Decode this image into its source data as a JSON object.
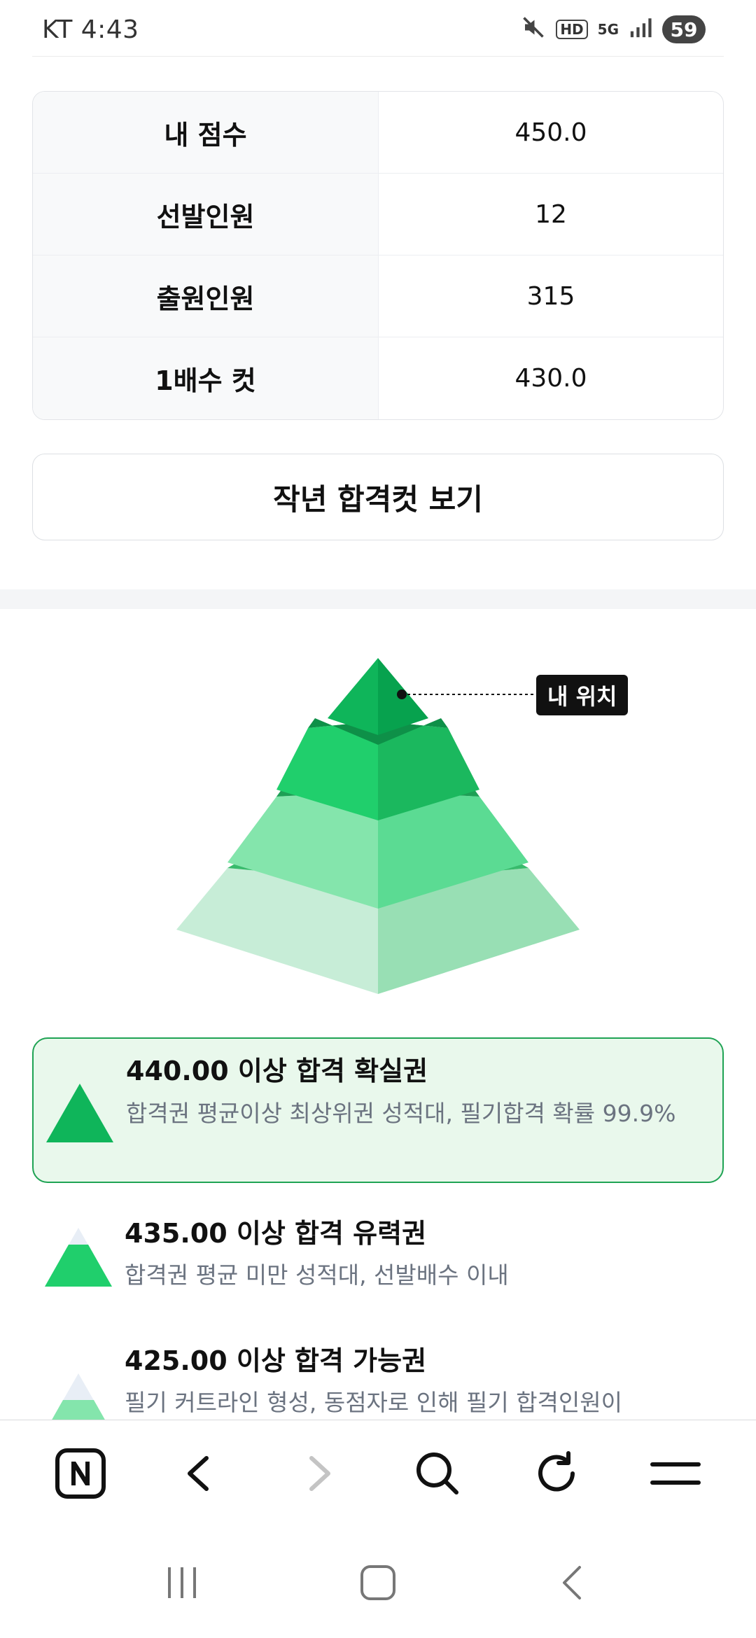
{
  "status": {
    "carrier_time": "KT 4:43",
    "hd": "HD",
    "network": "5G",
    "battery": "59"
  },
  "info_table": [
    {
      "label": "내 점수",
      "value": "450.0"
    },
    {
      "label": "선발인원",
      "value": "12"
    },
    {
      "label": "출원인원",
      "value": "315"
    },
    {
      "label": "1배수 컷",
      "value": "430.0"
    }
  ],
  "prev_cut_button": "작년 합격컷 보기",
  "pyramid": {
    "my_position_label": "내 위치",
    "colors": {
      "tier1": "#0fb55a",
      "tier2": "#20cf6c",
      "tier3": "#84e5ac",
      "tier4": "#c7edd7"
    }
  },
  "levels": [
    {
      "title": "440.00 이상 합격 확실권",
      "desc": "합격권 평균이상 최상위권 성적대, 필기합격 확률 99.9%"
    },
    {
      "title": "435.00 이상 합격 유력권",
      "desc": "합격권 평균 미만 성적대, 선발배수 이내"
    },
    {
      "title": "425.00 이상 합격 가능권",
      "desc": "필기 커트라인 형성, 동점자로 인해 필기 합격인원이"
    }
  ]
}
